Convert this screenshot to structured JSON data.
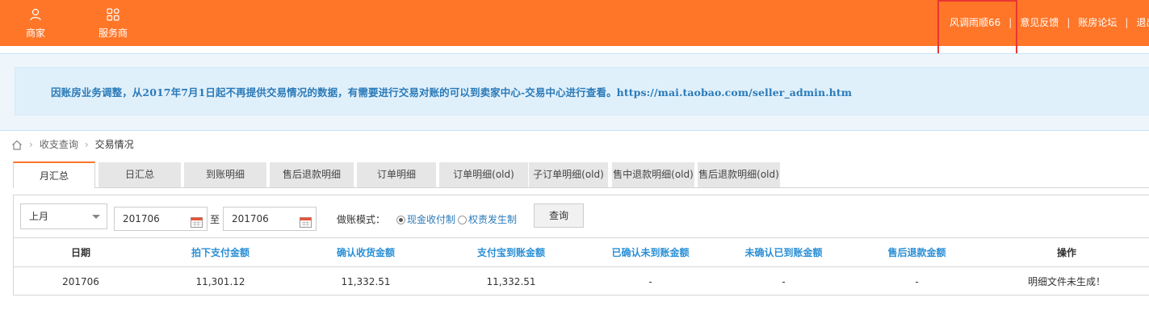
{
  "colors": {
    "brand_orange": "#ff7628",
    "link_blue": "#2a7ab8",
    "header_blue": "#2a8fd5",
    "highlight_red": "#e83535"
  },
  "topbar": {
    "nav": [
      {
        "label": "商家",
        "icon": "user-icon"
      },
      {
        "label": "服务商",
        "icon": "grid-icon"
      }
    ],
    "links": [
      "风调雨顺66",
      "意见反馈",
      "账房论坛",
      "退出"
    ],
    "separator": "|"
  },
  "notice": {
    "text": "因账房业务调整，从2017年7月1日起不再提供交易情况的数据，有需要进行交易对账的可以到卖家中心-交易中心进行查看。https://mai.taobao.com/seller_admin.htm"
  },
  "breadcrumb": {
    "parent": "收支查询",
    "current": "交易情况",
    "home_icon": "home-icon"
  },
  "tabs": [
    {
      "label": "月汇总",
      "active": true
    },
    {
      "label": "日汇总",
      "active": false
    },
    {
      "label": "到账明细",
      "active": false
    },
    {
      "label": "售后退款明细",
      "active": false
    },
    {
      "label": "订单明细",
      "active": false
    },
    {
      "label": "订单明细(old)",
      "active": false
    },
    {
      "label": "子订单明细(old)",
      "active": false
    },
    {
      "label": "售中退款明细(old)",
      "active": false
    },
    {
      "label": "售后退款明细(old)",
      "active": false
    }
  ],
  "filter": {
    "period_select": "上月",
    "date_from": "201706",
    "to_label": "至",
    "date_to": "201706",
    "mode_label": "做账模式：",
    "mode_options": [
      {
        "label": "现金收付制",
        "selected": true
      },
      {
        "label": "权责发生制",
        "selected": false
      }
    ],
    "query_button": "查询"
  },
  "table": {
    "headers": [
      "日期",
      "拍下支付金额",
      "确认收货金额",
      "支付宝到账金额",
      "已确认未到账金额",
      "未确认已到账金额",
      "售后退款金额",
      "操作"
    ],
    "rows": [
      [
        "201706",
        "11,301.12",
        "11,332.51",
        "11,332.51",
        "-",
        "-",
        "-",
        "明细文件未生成！"
      ]
    ]
  }
}
